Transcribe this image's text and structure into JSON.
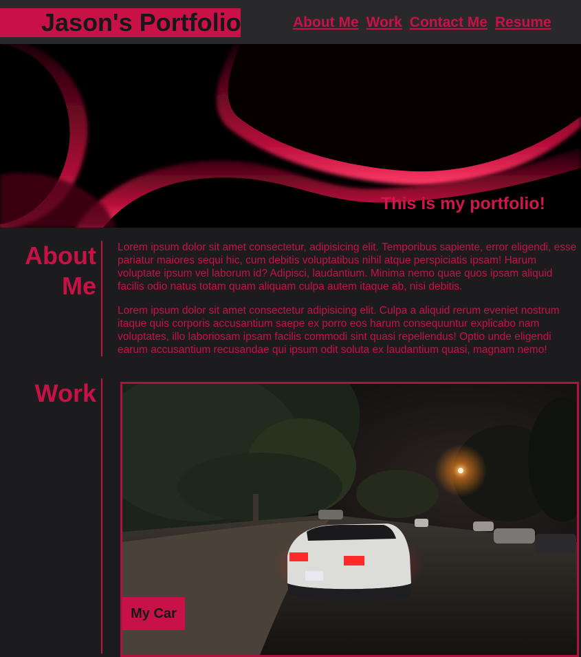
{
  "header": {
    "brand": "Jason's Portfolio",
    "nav": [
      "About Me",
      "Work",
      "Contact Me",
      "Resume"
    ]
  },
  "hero": {
    "tagline": "This is my portfolio!"
  },
  "about": {
    "title": "About Me",
    "paragraphs": [
      "Lorem ipsum dolor sit amet consectetur, adipisicing elit. Temporibus sapiente, error eligendi, esse pariatur maiores sequi hic, cum debitis voluptatibus nihil atque perspiciatis ipsam! Harum voluptate ipsum vel laborum id? Adipisci, laudantium. Minima nemo quae quos ipsam aliquid facilis odio natus totam quam aliquam culpa autem itaque ab, nisi debitis.",
      "Lorem ipsum dolor sit amet consectetur adipisicing elit. Culpa a aliquid rerum eveniet nostrum itaque quis corporis accusantium saepe ex porro eos harum consequuntur explicabo nam voluptates, illo laboriosam ipsam facilis commodi sint quasi repellendus! Optio unde eligendi earum accusantium recusandae qui ipsum odit soluta ex laudantium quasi, magnam nemo!"
    ]
  },
  "work": {
    "title": "Work",
    "projects": [
      {
        "label": "My Car"
      }
    ]
  },
  "colors": {
    "accent": "#c81247",
    "background": "#1c1c1e",
    "header_bg": "#29292b"
  }
}
